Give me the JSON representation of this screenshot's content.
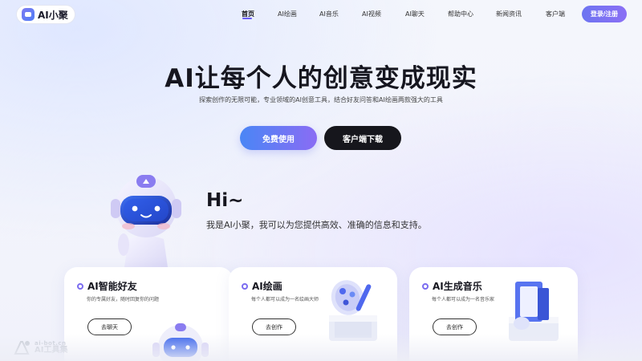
{
  "header": {
    "logo_text": "AI小聚",
    "nav": [
      {
        "label": "首页",
        "active": true
      },
      {
        "label": "AI绘画",
        "active": false
      },
      {
        "label": "AI音乐",
        "active": false
      },
      {
        "label": "AI视频",
        "active": false
      },
      {
        "label": "AI聊天",
        "active": false
      },
      {
        "label": "帮助中心",
        "active": false
      },
      {
        "label": "新闻资讯",
        "active": false
      },
      {
        "label": "客户端",
        "active": false
      }
    ],
    "login_label": "登录/注册"
  },
  "hero": {
    "title": "AI让每个人的创意变成现实",
    "subtitle": "探索创作的无限可能，专业领域的AI创意工具，结合好友问答和AI绘画两款强大的工具",
    "primary_button": "免费使用",
    "secondary_button": "客户端下载"
  },
  "assistant": {
    "greeting": "Hi~",
    "intro": "我是AI小聚，我可以为您提供高效、准确的信息和支持。"
  },
  "cards": [
    {
      "title": "AI智能好友",
      "desc": "你的专属好友，随时回复你的问题",
      "button": "去聊天",
      "icon": "robot-icon"
    },
    {
      "title": "AI绘画",
      "desc": "每个人都可以成为一名绘画大师",
      "button": "去创作",
      "icon": "palette-icon"
    },
    {
      "title": "AI生成音乐",
      "desc": "每个人都可以成为一名音乐家",
      "button": "去创作",
      "icon": "music-icon"
    }
  ],
  "watermark": {
    "url": "ai-bot.cn",
    "name": "AI工具集"
  },
  "colors": {
    "accent": "#6a5ef5",
    "primary_gradient_start": "#4a86f5",
    "primary_gradient_end": "#8a6cf4",
    "dark_button": "#16161c"
  }
}
